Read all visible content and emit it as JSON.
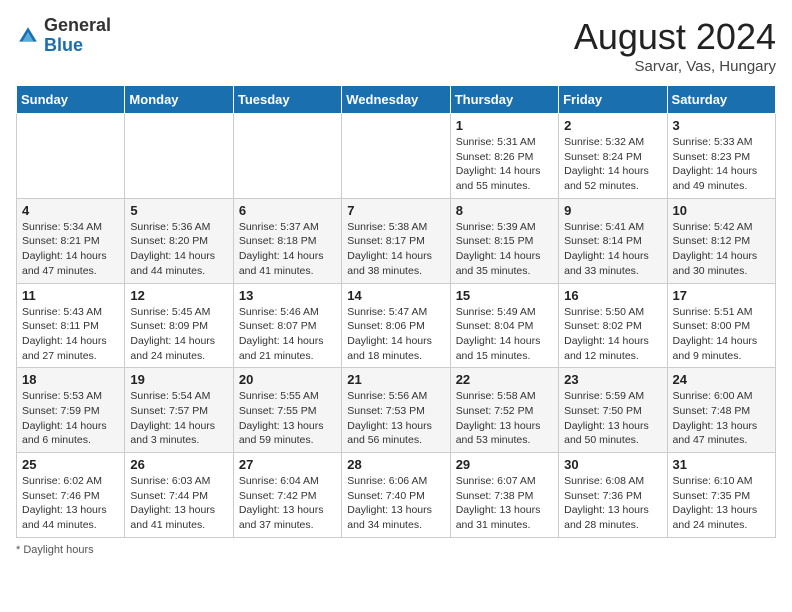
{
  "header": {
    "logo_general": "General",
    "logo_blue": "Blue",
    "month_year": "August 2024",
    "location": "Sarvar, Vas, Hungary"
  },
  "days_of_week": [
    "Sunday",
    "Monday",
    "Tuesday",
    "Wednesday",
    "Thursday",
    "Friday",
    "Saturday"
  ],
  "weeks": [
    [
      {
        "day": "",
        "info": ""
      },
      {
        "day": "",
        "info": ""
      },
      {
        "day": "",
        "info": ""
      },
      {
        "day": "",
        "info": ""
      },
      {
        "day": "1",
        "info": "Sunrise: 5:31 AM\nSunset: 8:26 PM\nDaylight: 14 hours\nand 55 minutes."
      },
      {
        "day": "2",
        "info": "Sunrise: 5:32 AM\nSunset: 8:24 PM\nDaylight: 14 hours\nand 52 minutes."
      },
      {
        "day": "3",
        "info": "Sunrise: 5:33 AM\nSunset: 8:23 PM\nDaylight: 14 hours\nand 49 minutes."
      }
    ],
    [
      {
        "day": "4",
        "info": "Sunrise: 5:34 AM\nSunset: 8:21 PM\nDaylight: 14 hours\nand 47 minutes."
      },
      {
        "day": "5",
        "info": "Sunrise: 5:36 AM\nSunset: 8:20 PM\nDaylight: 14 hours\nand 44 minutes."
      },
      {
        "day": "6",
        "info": "Sunrise: 5:37 AM\nSunset: 8:18 PM\nDaylight: 14 hours\nand 41 minutes."
      },
      {
        "day": "7",
        "info": "Sunrise: 5:38 AM\nSunset: 8:17 PM\nDaylight: 14 hours\nand 38 minutes."
      },
      {
        "day": "8",
        "info": "Sunrise: 5:39 AM\nSunset: 8:15 PM\nDaylight: 14 hours\nand 35 minutes."
      },
      {
        "day": "9",
        "info": "Sunrise: 5:41 AM\nSunset: 8:14 PM\nDaylight: 14 hours\nand 33 minutes."
      },
      {
        "day": "10",
        "info": "Sunrise: 5:42 AM\nSunset: 8:12 PM\nDaylight: 14 hours\nand 30 minutes."
      }
    ],
    [
      {
        "day": "11",
        "info": "Sunrise: 5:43 AM\nSunset: 8:11 PM\nDaylight: 14 hours\nand 27 minutes."
      },
      {
        "day": "12",
        "info": "Sunrise: 5:45 AM\nSunset: 8:09 PM\nDaylight: 14 hours\nand 24 minutes."
      },
      {
        "day": "13",
        "info": "Sunrise: 5:46 AM\nSunset: 8:07 PM\nDaylight: 14 hours\nand 21 minutes."
      },
      {
        "day": "14",
        "info": "Sunrise: 5:47 AM\nSunset: 8:06 PM\nDaylight: 14 hours\nand 18 minutes."
      },
      {
        "day": "15",
        "info": "Sunrise: 5:49 AM\nSunset: 8:04 PM\nDaylight: 14 hours\nand 15 minutes."
      },
      {
        "day": "16",
        "info": "Sunrise: 5:50 AM\nSunset: 8:02 PM\nDaylight: 14 hours\nand 12 minutes."
      },
      {
        "day": "17",
        "info": "Sunrise: 5:51 AM\nSunset: 8:00 PM\nDaylight: 14 hours\nand 9 minutes."
      }
    ],
    [
      {
        "day": "18",
        "info": "Sunrise: 5:53 AM\nSunset: 7:59 PM\nDaylight: 14 hours\nand 6 minutes."
      },
      {
        "day": "19",
        "info": "Sunrise: 5:54 AM\nSunset: 7:57 PM\nDaylight: 14 hours\nand 3 minutes."
      },
      {
        "day": "20",
        "info": "Sunrise: 5:55 AM\nSunset: 7:55 PM\nDaylight: 13 hours\nand 59 minutes."
      },
      {
        "day": "21",
        "info": "Sunrise: 5:56 AM\nSunset: 7:53 PM\nDaylight: 13 hours\nand 56 minutes."
      },
      {
        "day": "22",
        "info": "Sunrise: 5:58 AM\nSunset: 7:52 PM\nDaylight: 13 hours\nand 53 minutes."
      },
      {
        "day": "23",
        "info": "Sunrise: 5:59 AM\nSunset: 7:50 PM\nDaylight: 13 hours\nand 50 minutes."
      },
      {
        "day": "24",
        "info": "Sunrise: 6:00 AM\nSunset: 7:48 PM\nDaylight: 13 hours\nand 47 minutes."
      }
    ],
    [
      {
        "day": "25",
        "info": "Sunrise: 6:02 AM\nSunset: 7:46 PM\nDaylight: 13 hours\nand 44 minutes."
      },
      {
        "day": "26",
        "info": "Sunrise: 6:03 AM\nSunset: 7:44 PM\nDaylight: 13 hours\nand 41 minutes."
      },
      {
        "day": "27",
        "info": "Sunrise: 6:04 AM\nSunset: 7:42 PM\nDaylight: 13 hours\nand 37 minutes."
      },
      {
        "day": "28",
        "info": "Sunrise: 6:06 AM\nSunset: 7:40 PM\nDaylight: 13 hours\nand 34 minutes."
      },
      {
        "day": "29",
        "info": "Sunrise: 6:07 AM\nSunset: 7:38 PM\nDaylight: 13 hours\nand 31 minutes."
      },
      {
        "day": "30",
        "info": "Sunrise: 6:08 AM\nSunset: 7:36 PM\nDaylight: 13 hours\nand 28 minutes."
      },
      {
        "day": "31",
        "info": "Sunrise: 6:10 AM\nSunset: 7:35 PM\nDaylight: 13 hours\nand 24 minutes."
      }
    ]
  ],
  "footer": {
    "label": "Daylight hours"
  }
}
